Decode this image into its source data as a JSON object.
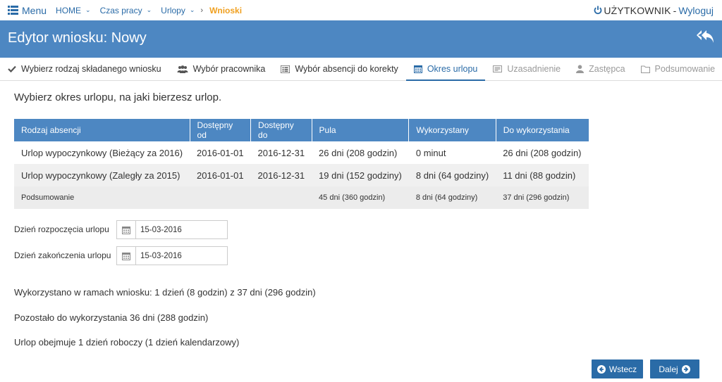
{
  "topnav": {
    "menu_label": "Menu",
    "breadcrumbs": [
      {
        "label": "HOME"
      },
      {
        "label": "Czas pracy"
      },
      {
        "label": "Urlopy"
      },
      {
        "label": "Wnioski"
      }
    ],
    "user_name": "UŻYTKOWNIK",
    "separator": "-",
    "logout_label": "Wyloguj"
  },
  "header": {
    "title": "Edytor wniosku: Nowy"
  },
  "tabs": [
    {
      "label": "Wybierz rodzaj składanego wniosku",
      "icon": "check-icon",
      "state": "done"
    },
    {
      "label": "Wybór pracownika",
      "icon": "users-icon",
      "state": "done"
    },
    {
      "label": "Wybór absencji do korekty",
      "icon": "list-icon",
      "state": "done"
    },
    {
      "label": "Okres urlopu",
      "icon": "calendar-icon",
      "state": "active"
    },
    {
      "label": "Uzasadnienie",
      "icon": "text-icon",
      "state": "disabled"
    },
    {
      "label": "Zastępca",
      "icon": "user-icon",
      "state": "disabled"
    },
    {
      "label": "Podsumowanie",
      "icon": "folder-icon",
      "state": "disabled"
    }
  ],
  "main": {
    "instruction": "Wybierz okres urlopu, na jaki bierzesz urlop.",
    "table": {
      "headers": [
        "Rodzaj absencji",
        "Dostępny od",
        "Dostępny do",
        "Pula",
        "Wykorzystany",
        "Do wykorzystania"
      ],
      "rows": [
        [
          "Urlop wypoczynkowy (Bieżący za 2016)",
          "2016-01-01",
          "2016-12-31",
          "26 dni (208 godzin)",
          "0 minut",
          "26 dni (208 godzin)"
        ],
        [
          "Urlop wypoczynkowy (Zaległy za 2015)",
          "2016-01-01",
          "2016-12-31",
          "19 dni (152 godziny)",
          "8 dni (64 godziny)",
          "11 dni (88 godzin)"
        ]
      ],
      "summary": [
        "Podsumowanie",
        "",
        "",
        "45 dni (360 godzin)",
        "8 dni (64 godziny)",
        "37 dni (296 godzin)"
      ]
    },
    "start_label": "Dzień rozpoczęcia urlopu",
    "start_value": "15-03-2016",
    "end_label": "Dzień zakończenia urlopu",
    "end_value": "15-03-2016",
    "info1": "Wykorzystano w ramach wniosku: 1 dzień (8 godzin) z 37 dni (296 godzin)",
    "info2": "Pozostało do wykorzystania 36 dni (288 godzin)",
    "info3": "Urlop obejmuje 1 dzień roboczy (1 dzień kalendarzowy)"
  },
  "buttons": {
    "back_label": "Wstecz",
    "next_label": "Dalej"
  },
  "colors": {
    "primary": "#4d87c2",
    "link": "#2a6ba7",
    "active_crumb": "#f0a020"
  }
}
